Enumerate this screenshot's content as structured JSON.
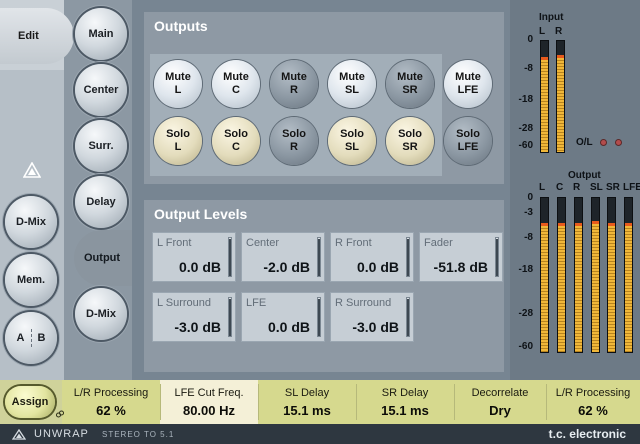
{
  "left_nav": {
    "edit_label": "Edit",
    "main_label": "Main",
    "center_label": "Center",
    "surr_label": "Surr.",
    "delay_label": "Delay",
    "output_label": "Output",
    "dmix_label": "D-Mix",
    "dmix_left_label": "D-Mix",
    "mem_label": "Mem.",
    "ab_a": "A",
    "ab_b": "B"
  },
  "outputs": {
    "title": "Outputs",
    "mute": [
      {
        "top": "Mute",
        "bottom": "L",
        "state": "on"
      },
      {
        "top": "Mute",
        "bottom": "C",
        "state": "on"
      },
      {
        "top": "Mute",
        "bottom": "R",
        "state": "off"
      },
      {
        "top": "Mute",
        "bottom": "SL",
        "state": "on"
      },
      {
        "top": "Mute",
        "bottom": "SR",
        "state": "off"
      },
      {
        "top": "Mute",
        "bottom": "LFE",
        "state": "on"
      }
    ],
    "solo": [
      {
        "top": "Solo",
        "bottom": "L",
        "state": "on"
      },
      {
        "top": "Solo",
        "bottom": "C",
        "state": "on"
      },
      {
        "top": "Solo",
        "bottom": "R",
        "state": "off"
      },
      {
        "top": "Solo",
        "bottom": "SL",
        "state": "on"
      },
      {
        "top": "Solo",
        "bottom": "SR",
        "state": "on"
      },
      {
        "top": "Solo",
        "bottom": "LFE",
        "state": "off"
      }
    ]
  },
  "output_levels": {
    "title": "Output Levels",
    "items": [
      {
        "name": "L Front",
        "value": "0.0 dB",
        "level": 0.97
      },
      {
        "name": "Center",
        "value": "-2.0 dB",
        "level": 0.97
      },
      {
        "name": "R Front",
        "value": "0.0 dB",
        "level": 0.97
      },
      {
        "name": "Fader",
        "value": "-51.8 dB",
        "level": 0.97
      },
      {
        "name": "L Surround",
        "value": "-3.0 dB",
        "level": 0.97
      },
      {
        "name": "LFE",
        "value": "0.0 dB",
        "level": 0.97
      },
      {
        "name": "R Surround",
        "value": "-3.0 dB",
        "level": 0.97
      }
    ]
  },
  "input_meters": {
    "title": "Input",
    "channels": [
      "L",
      "R"
    ],
    "scale": [
      "0",
      "-8",
      "-18",
      "-28",
      "-60"
    ],
    "levels": [
      0.83,
      0.85
    ],
    "ol_label": "O/L"
  },
  "output_meters": {
    "title": "Output",
    "channels": [
      "L",
      "C",
      "R",
      "SL",
      "SR",
      "LFE"
    ],
    "scale": [
      "0",
      "-3",
      "-8",
      "-18",
      "-28",
      "-60"
    ],
    "levels": [
      0.82,
      0.82,
      0.82,
      0.83,
      0.82,
      0.82
    ]
  },
  "bottom_bar": {
    "assign_label": "Assign",
    "params": [
      {
        "name": "L/R Processing",
        "value": "62 %",
        "active": false
      },
      {
        "name": "LFE Cut Freq.",
        "value": "80.00 Hz",
        "active": true
      },
      {
        "name": "SL Delay",
        "value": "15.1 ms",
        "active": false
      },
      {
        "name": "SR Delay",
        "value": "15.1 ms",
        "active": false
      },
      {
        "name": "Decorrelate",
        "value": "Dry",
        "active": false
      },
      {
        "name": "L/R Processing",
        "value": "62 %",
        "active": false
      }
    ]
  },
  "footer": {
    "title": "UNWRAP",
    "subtitle": "STEREO TO 5.1",
    "brand": "t.c. electronic"
  },
  "colors": {
    "meter_fill": "#f0b739",
    "meter_peak": "#e85a1c",
    "panel": "#8e99a4",
    "bottom_bar": "#d6d98e"
  }
}
